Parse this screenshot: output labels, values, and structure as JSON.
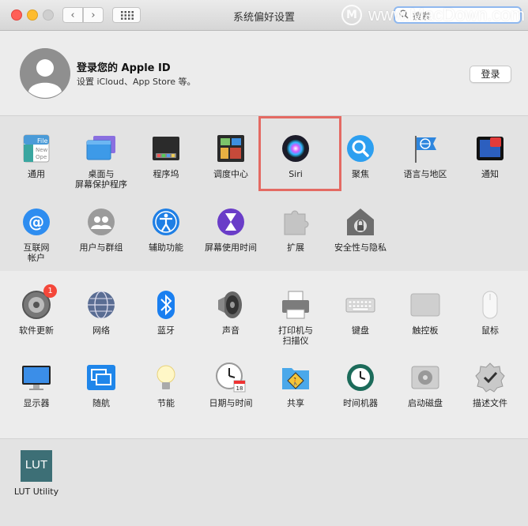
{
  "window": {
    "title": "系统偏好设置"
  },
  "toolbar": {
    "back": "‹",
    "forward": "›"
  },
  "search": {
    "placeholder": "搜索"
  },
  "watermark": {
    "logo": "M",
    "text": "www.MacDown.com"
  },
  "account": {
    "title": "登录您的 Apple ID",
    "subtitle": "设置 iCloud、App Store 等。",
    "login_label": "登录"
  },
  "rows": [
    [
      {
        "label": "通用",
        "icon": "general-icon"
      },
      {
        "label": "桌面与\n屏幕保护程序",
        "icon": "desktop-screensaver-icon"
      },
      {
        "label": "程序坞",
        "icon": "dock-icon"
      },
      {
        "label": "调度中心",
        "icon": "mission-control-icon"
      },
      {
        "label": "Siri",
        "icon": "siri-icon"
      },
      {
        "label": "聚焦",
        "icon": "spotlight-icon"
      },
      {
        "label": "语言与地区",
        "icon": "language-region-icon"
      },
      {
        "label": "通知",
        "icon": "notifications-icon"
      }
    ],
    [
      {
        "label": "互联网\n帐户",
        "icon": "internet-accounts-icon"
      },
      {
        "label": "用户与群组",
        "icon": "users-groups-icon"
      },
      {
        "label": "辅助功能",
        "icon": "accessibility-icon"
      },
      {
        "label": "屏幕使用时间",
        "icon": "screen-time-icon"
      },
      {
        "label": "扩展",
        "icon": "extensions-icon"
      },
      {
        "label": "安全性与隐私",
        "icon": "security-privacy-icon"
      }
    ],
    [
      {
        "label": "软件更新",
        "icon": "software-update-icon",
        "badge": "1"
      },
      {
        "label": "网络",
        "icon": "network-icon"
      },
      {
        "label": "蓝牙",
        "icon": "bluetooth-icon"
      },
      {
        "label": "声音",
        "icon": "sound-icon"
      },
      {
        "label": "打印机与\n扫描仪",
        "icon": "printers-scanners-icon"
      },
      {
        "label": "键盘",
        "icon": "keyboard-icon"
      },
      {
        "label": "触控板",
        "icon": "trackpad-icon"
      },
      {
        "label": "鼠标",
        "icon": "mouse-icon"
      }
    ],
    [
      {
        "label": "显示器",
        "icon": "displays-icon"
      },
      {
        "label": "随航",
        "icon": "sidecar-icon"
      },
      {
        "label": "节能",
        "icon": "energy-saver-icon"
      },
      {
        "label": "日期与时间",
        "icon": "date-time-icon"
      },
      {
        "label": "共享",
        "icon": "sharing-icon"
      },
      {
        "label": "时间机器",
        "icon": "time-machine-icon"
      },
      {
        "label": "启动磁盘",
        "icon": "startup-disk-icon"
      },
      {
        "label": "描述文件",
        "icon": "profiles-icon"
      }
    ],
    [
      {
        "label": "LUT Utility",
        "icon": "lut-utility-icon",
        "icon_text": "LUT"
      }
    ]
  ],
  "general_icon_text": [
    "File",
    "New",
    "Ope"
  ],
  "date_icon": {
    "month": "JUL",
    "day": "18"
  }
}
